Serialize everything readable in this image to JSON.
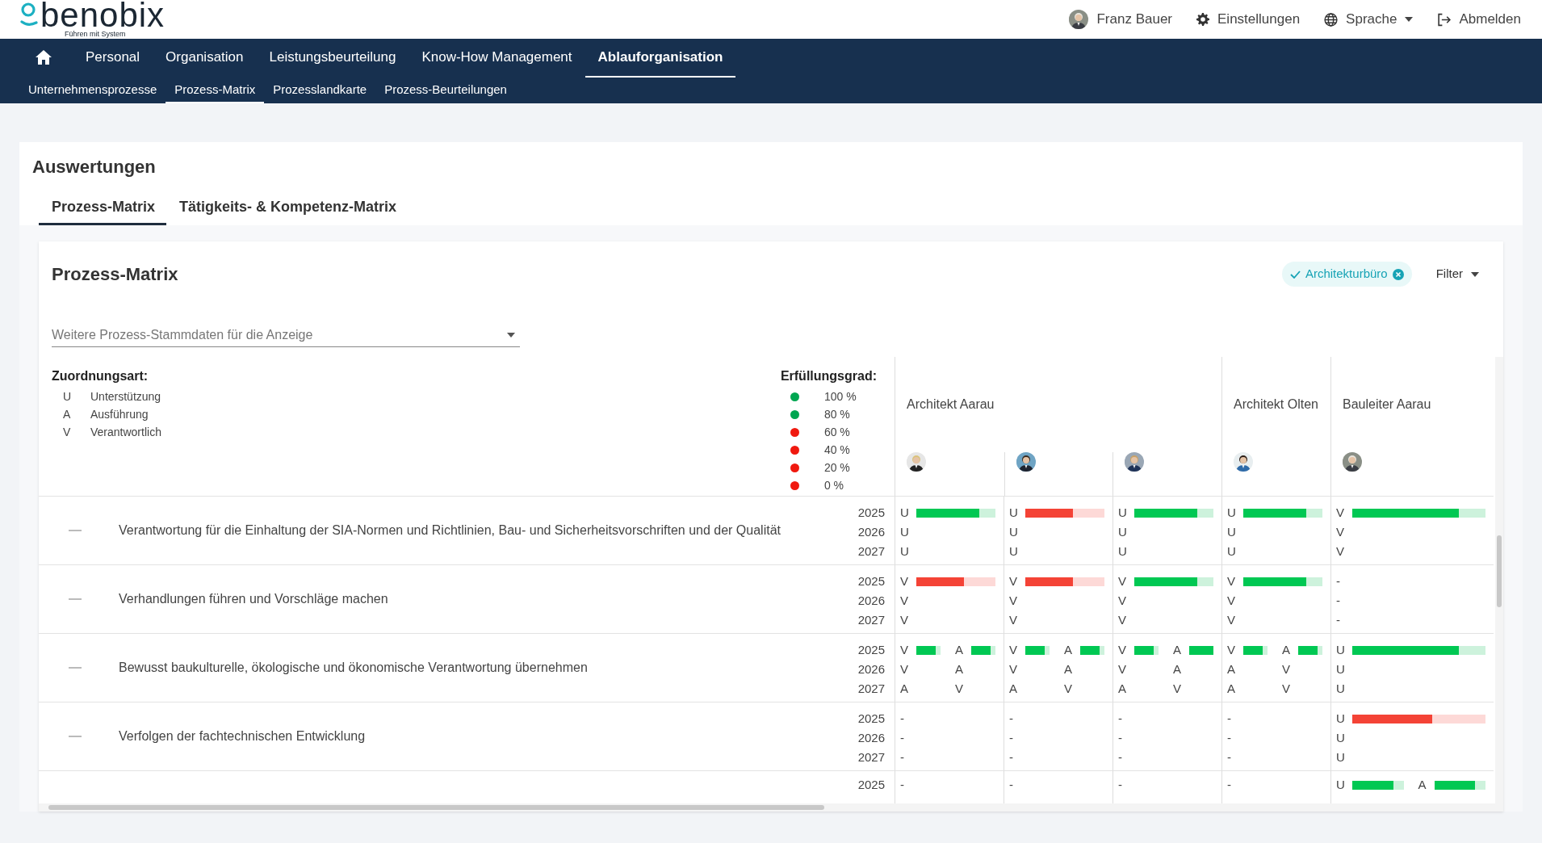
{
  "header": {
    "logo": {
      "name": "benobix",
      "tagline": "Führen mit System"
    },
    "user": {
      "name": "Franz Bauer"
    },
    "links": [
      {
        "kind": "settings",
        "label": "Einstellungen",
        "dropdown": false
      },
      {
        "kind": "language",
        "label": "Sprache",
        "dropdown": true
      },
      {
        "kind": "logout",
        "label": "Abmelden",
        "dropdown": false
      }
    ]
  },
  "nav": {
    "items": [
      {
        "kind": "home",
        "selected": false
      },
      {
        "kind": "link",
        "label": "Personal",
        "selected": false
      },
      {
        "kind": "link",
        "label": "Organisation",
        "selected": false
      },
      {
        "kind": "link",
        "label": "Leistungsbeurteilung",
        "selected": false
      },
      {
        "kind": "link",
        "label": "Know-How Management",
        "selected": false
      },
      {
        "kind": "link",
        "label": "Ablauforganisation",
        "selected": true
      }
    ]
  },
  "subnav": {
    "items": [
      {
        "label": "Unternehmensprozesse",
        "selected": false
      },
      {
        "label": "Prozess-Matrix",
        "selected": true
      },
      {
        "label": "Prozesslandkarte",
        "selected": false
      },
      {
        "label": "Prozess-Beurteilungen",
        "selected": false
      }
    ]
  },
  "page": {
    "title": "Auswertungen",
    "tabs": [
      {
        "label": "Prozess-Matrix",
        "selected": true
      },
      {
        "label": "Tätigkeits- & Kompetenz-Matrix",
        "selected": false
      }
    ]
  },
  "matrix": {
    "title": "Prozess-Matrix",
    "filters": [
      {
        "label": "Architekturbüro",
        "active": true
      }
    ],
    "filter_button": "Filter",
    "select": {
      "placeholder": "Weitere Prozess-Stammdaten für die Anzeige"
    },
    "assignment_legend": {
      "title": "Zuordnungsart:",
      "items": [
        {
          "code": "U",
          "label": "Unterstützung"
        },
        {
          "code": "A",
          "label": "Ausführung"
        },
        {
          "code": "V",
          "label": "Verantwortlich"
        }
      ]
    },
    "fulfillment_legend": {
      "title": "Erfüllungsgrad:",
      "items": [
        {
          "label": "100 %",
          "color": "#00a651"
        },
        {
          "label": "80 %",
          "color": "#00a651"
        },
        {
          "label": "60 %",
          "color": "#f0190f"
        },
        {
          "label": "40 %",
          "color": "#f0190f"
        },
        {
          "label": "20 %",
          "color": "#f0190f"
        },
        {
          "label": "0 %",
          "color": "#f0190f"
        }
      ]
    },
    "groups": [
      {
        "title": "Architekt Aarau"
      },
      {
        "title": "Architekt Olten"
      },
      {
        "title": "Bauleiter Aarau"
      }
    ],
    "rows": [
      {
        "title": "Verantwortung für die Einhaltung der SIA-Normen und Richtlinien, Bau- und Sicherheitsvorschriften und der Qualität",
        "years": [
          "2025",
          "2026",
          "2027"
        ],
        "cells": [
          [
            [
              {
                "code": "U",
                "level": 0.8
              }
            ],
            [
              {
                "code": "U"
              }
            ],
            [
              {
                "code": "U"
              }
            ]
          ],
          [
            [
              {
                "code": "U",
                "level": 0.6
              }
            ],
            [
              {
                "code": "U"
              }
            ],
            [
              {
                "code": "U"
              }
            ]
          ],
          [
            [
              {
                "code": "U",
                "level": 0.8
              }
            ],
            [
              {
                "code": "U"
              }
            ],
            [
              {
                "code": "U"
              }
            ]
          ],
          [
            [
              {
                "code": "U",
                "level": 0.8
              }
            ],
            [
              {
                "code": "U"
              }
            ],
            [
              {
                "code": "U"
              }
            ]
          ],
          [
            [
              {
                "code": "V",
                "level": 0.8
              }
            ],
            [
              {
                "code": "V"
              }
            ],
            [
              {
                "code": "V"
              }
            ]
          ]
        ]
      },
      {
        "title": "Verhandlungen führen und Vorschläge machen",
        "years": [
          "2025",
          "2026",
          "2027"
        ],
        "cells": [
          [
            [
              {
                "code": "V",
                "level": 0.6
              }
            ],
            [
              {
                "code": "V"
              }
            ],
            [
              {
                "code": "V"
              }
            ]
          ],
          [
            [
              {
                "code": "V",
                "level": 0.6
              }
            ],
            [
              {
                "code": "V"
              }
            ],
            [
              {
                "code": "V"
              }
            ]
          ],
          [
            [
              {
                "code": "V",
                "level": 0.8
              }
            ],
            [
              {
                "code": "V"
              }
            ],
            [
              {
                "code": "V"
              }
            ]
          ],
          [
            [
              {
                "code": "V",
                "level": 0.8
              }
            ],
            [
              {
                "code": "V"
              }
            ],
            [
              {
                "code": "V"
              }
            ]
          ],
          [
            [
              {
                "code": "-"
              }
            ],
            [
              {
                "code": "-"
              }
            ],
            [
              {
                "code": "-"
              }
            ]
          ]
        ]
      },
      {
        "title": "Bewusst baukulturelle, ökologische und ökonomische Verantwortung übernehmen",
        "years": [
          "2025",
          "2026",
          "2027"
        ],
        "cells": [
          [
            [
              {
                "code": "V",
                "level": 0.8
              },
              {
                "code": "A",
                "level": 0.8
              }
            ],
            [
              {
                "code": "V"
              },
              {
                "code": "A"
              }
            ],
            [
              {
                "code": "A"
              },
              {
                "code": "V"
              }
            ]
          ],
          [
            [
              {
                "code": "V",
                "level": 0.8
              },
              {
                "code": "A",
                "level": 0.8
              }
            ],
            [
              {
                "code": "V"
              },
              {
                "code": "A"
              }
            ],
            [
              {
                "code": "A"
              },
              {
                "code": "V"
              }
            ]
          ],
          [
            [
              {
                "code": "V",
                "level": 0.8
              },
              {
                "code": "A",
                "level": 1
              }
            ],
            [
              {
                "code": "V"
              },
              {
                "code": "A"
              }
            ],
            [
              {
                "code": "A"
              },
              {
                "code": "V"
              }
            ]
          ],
          [
            [
              {
                "code": "V",
                "level": 0.8
              },
              {
                "code": "A",
                "level": 0.8
              }
            ],
            [
              {
                "code": "A"
              },
              {
                "code": "V"
              }
            ],
            [
              {
                "code": "A"
              },
              {
                "code": "V"
              }
            ]
          ],
          [
            [
              {
                "code": "U",
                "level": 0.8
              }
            ],
            [
              {
                "code": "U"
              }
            ],
            [
              {
                "code": "U"
              }
            ]
          ]
        ]
      },
      {
        "title": "Verfolgen der fachtechnischen Entwicklung",
        "years": [
          "2025",
          "2026",
          "2027"
        ],
        "cells": [
          [
            [
              {
                "code": "-"
              }
            ],
            [
              {
                "code": "-"
              }
            ],
            [
              {
                "code": "-"
              }
            ]
          ],
          [
            [
              {
                "code": "-"
              }
            ],
            [
              {
                "code": "-"
              }
            ],
            [
              {
                "code": "-"
              }
            ]
          ],
          [
            [
              {
                "code": "-"
              }
            ],
            [
              {
                "code": "-"
              }
            ],
            [
              {
                "code": "-"
              }
            ]
          ],
          [
            [
              {
                "code": "-"
              }
            ],
            [
              {
                "code": "-"
              }
            ],
            [
              {
                "code": "-"
              }
            ]
          ],
          [
            [
              {
                "code": "U",
                "level": 0.6
              }
            ],
            [
              {
                "code": "U"
              }
            ],
            [
              {
                "code": "U"
              }
            ]
          ]
        ]
      },
      {
        "years": [
          "2025"
        ],
        "cells": [
          [
            [
              {
                "code": "-"
              }
            ]
          ],
          [
            [
              {
                "code": "-"
              }
            ]
          ],
          [
            [
              {
                "code": "-"
              }
            ]
          ],
          [
            [
              {
                "code": "-"
              }
            ]
          ],
          [
            [
              {
                "code": "U",
                "level": 0.8
              },
              {
                "code": "A",
                "level": 0.8
              }
            ]
          ]
        ]
      }
    ]
  }
}
